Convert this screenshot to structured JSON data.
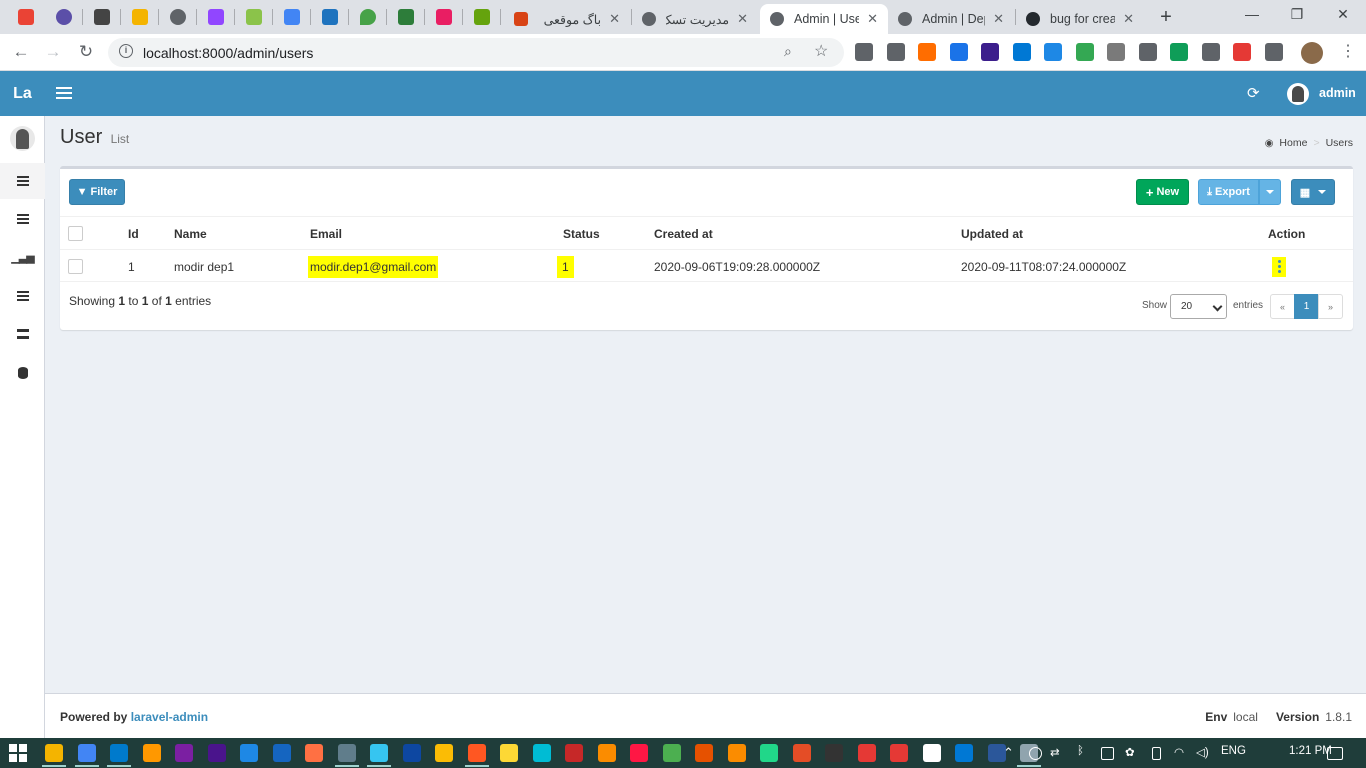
{
  "browser": {
    "tabs": [
      {
        "title": "باگ موقعی",
        "active": false
      },
      {
        "title": "مدیریت تسک",
        "active": false
      },
      {
        "title": "Admin | Users",
        "active": true
      },
      {
        "title": "Admin | Dep",
        "active": false
      },
      {
        "title": "bug for crea",
        "active": false
      }
    ],
    "new_tab": "+",
    "url": "localhost:8000/admin/users",
    "window_controls": {
      "minimize": "—",
      "restore": "❐",
      "close": "✕"
    },
    "pinned_colors": [
      "#ea4335",
      "#5b4fa8",
      "#444444",
      "#f4b400",
      "#5f6368",
      "#9146ff",
      "#8bc34a",
      "#4285f4",
      "#1e73be",
      "#47a248",
      "#2d7d3a",
      "#e91e63",
      "#65a30d",
      "#d84315"
    ],
    "extension_colors": [
      "#5f6368",
      "#5f6368",
      "#ff6d00",
      "#1a73e8",
      "#3c1e8c",
      "#0078d4",
      "#1e88e5",
      "#34a853",
      "#7a7a7a",
      "#5f6368",
      "#0f9d58",
      "#5f6368",
      "#e53935",
      "#5f6368"
    ]
  },
  "admin": {
    "logo": "La",
    "user_name": "admin",
    "page_title": "User",
    "page_subtitle": "List",
    "breadcrumb": {
      "home": "Home",
      "current": "Users"
    },
    "buttons": {
      "filter": "Filter",
      "new": "New",
      "export": "Export"
    },
    "table": {
      "headers": {
        "id": "Id",
        "name": "Name",
        "email": "Email",
        "status": "Status",
        "created_at": "Created at",
        "updated_at": "Updated at",
        "action": "Action"
      },
      "rows": [
        {
          "id": "1",
          "name": "modir dep1",
          "email": "modir.dep1@gmail.com",
          "status": "1",
          "created_at": "2020-09-06T19:09:28.000000Z",
          "updated_at": "2020-09-11T08:07:24.000000Z"
        }
      ]
    },
    "pagination": {
      "showing_prefix": "Showing ",
      "from": "1",
      "to_word": " to ",
      "to": "1",
      "of_word": " of ",
      "total": "1",
      "entries_word": " entries",
      "show_label": "Show",
      "per_page": "20",
      "entries_label": "entries",
      "prev": "«",
      "current_page": "1",
      "next": "»"
    },
    "footer": {
      "powered_by": "Powered by ",
      "powered_link": "laravel-admin",
      "env_label": "Env",
      "env_value": "local",
      "version_label": "Version",
      "version_value": "1.8.1"
    },
    "colors": {
      "header": "#3c8dbc",
      "new_button": "#00a65a",
      "highlight": "#ffff00"
    }
  },
  "taskbar": {
    "language": "ENG",
    "time": "1:21 PM",
    "app_colors": [
      "#f4b400",
      "#4285f4",
      "#007acc",
      "#ff9800",
      "#7b1fa2",
      "#4a148c",
      "#1e88e5",
      "#1565c0",
      "#ff7043",
      "#607d8b",
      "#36c5f0",
      "#0d47a1",
      "#fbbc05",
      "#ff5722",
      "#fdd835",
      "#00bcd4",
      "#c62828",
      "#fb8c00",
      "#ff1744",
      "#4caf50",
      "#e65100",
      "#fb8c00",
      "#21d789",
      "#e44d26",
      "#333333",
      "#e53935",
      "#e53935",
      "#ffffff",
      "#0078d4",
      "#2b579a",
      "#90a4ae"
    ]
  }
}
